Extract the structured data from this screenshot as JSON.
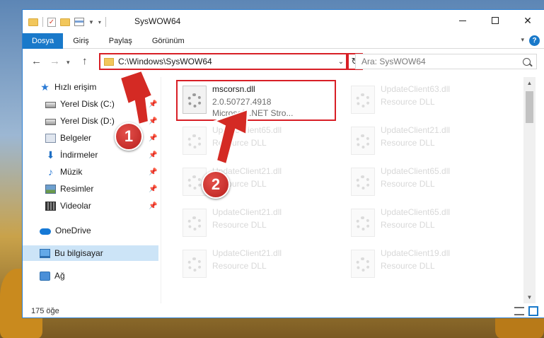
{
  "window": {
    "title": "SysWOW64"
  },
  "ribbon": {
    "tabs": [
      "Dosya",
      "Giriş",
      "Paylaş",
      "Görünüm"
    ]
  },
  "nav": {
    "address": "C:\\Windows\\SysWOW64",
    "search_placeholder": "Ara: SysWOW64"
  },
  "sidebar": {
    "items": [
      {
        "label": "Hızlı erişim",
        "icon": "star-icon"
      },
      {
        "label": "Yerel Disk (C:)",
        "icon": "disk-icon",
        "pinned": true
      },
      {
        "label": "Yerel Disk (D:)",
        "icon": "disk-icon",
        "pinned": true
      },
      {
        "label": "Belgeler",
        "icon": "documents-icon",
        "pinned": true
      },
      {
        "label": "İndirmeler",
        "icon": "download-icon",
        "pinned": true
      },
      {
        "label": "Müzik",
        "icon": "music-icon",
        "pinned": true
      },
      {
        "label": "Resimler",
        "icon": "pictures-icon",
        "pinned": true
      },
      {
        "label": "Videolar",
        "icon": "videos-icon",
        "pinned": true
      },
      {
        "label": "OneDrive",
        "icon": "cloud-icon"
      },
      {
        "label": "Bu bilgisayar",
        "icon": "computer-icon",
        "selected": true
      },
      {
        "label": "Ağ",
        "icon": "network-icon"
      }
    ]
  },
  "files": [
    {
      "name": "mscorsn.dll",
      "line2": "2.0.50727.4918",
      "line3": "Microsoft .NET Stro...",
      "faded": false
    },
    {
      "name": "UpdateClient63.dll",
      "line2": "Resource DLL",
      "faded": true
    },
    {
      "name": "UpdateClient65.dll",
      "line2": "Resource DLL",
      "faded": true
    },
    {
      "name": "UpdateClient21.dll",
      "line2": "Resource DLL",
      "faded": true
    },
    {
      "name": "UpdateClient21.dll",
      "line2": "Resource DLL",
      "faded": true
    },
    {
      "name": "UpdateClient65.dll",
      "line2": "Resource DLL",
      "faded": true
    },
    {
      "name": "UpdateClient21.dll",
      "line2": "Resource DLL",
      "faded": true
    },
    {
      "name": "UpdateClient65.dll",
      "line2": "Resource DLL",
      "faded": true
    },
    {
      "name": "UpdateClient21.dll",
      "line2": "Resource DLL",
      "faded": true
    },
    {
      "name": "UpdateClient19.dll",
      "line2": "Resource DLL",
      "faded": true
    }
  ],
  "status": {
    "count": "175 öğe"
  },
  "callouts": [
    "1",
    "2"
  ],
  "colors": {
    "accent": "#1979ca",
    "highlight": "#d81f26",
    "selection": "#cce4f7"
  }
}
